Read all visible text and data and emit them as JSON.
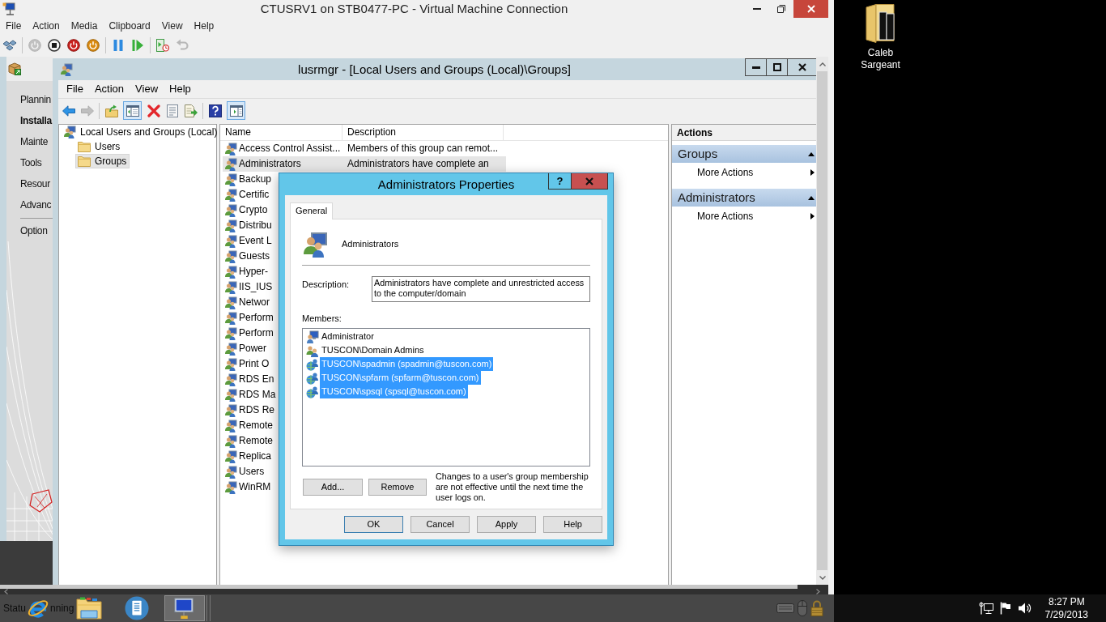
{
  "vm_window": {
    "title": "CTUSRV1 on STB0477-PC - Virtual Machine Connection",
    "menu": [
      "File",
      "Action",
      "Media",
      "Clipboard",
      "View",
      "Help"
    ],
    "toolbar": [
      {
        "kind": "ctrl-alt-del",
        "disabled": false
      },
      {
        "kind": "separator"
      },
      {
        "kind": "start",
        "disabled": true
      },
      {
        "kind": "turn-off",
        "disabled": false
      },
      {
        "kind": "shut-down",
        "disabled": false
      },
      {
        "kind": "save",
        "disabled": false
      },
      {
        "kind": "separator"
      },
      {
        "kind": "pause",
        "disabled": false
      },
      {
        "kind": "resume",
        "disabled": false
      },
      {
        "kind": "separator"
      },
      {
        "kind": "checkpoint",
        "disabled": false
      },
      {
        "kind": "revert",
        "disabled": true
      }
    ]
  },
  "sql_sidebar": {
    "items": [
      {
        "kind": "link",
        "label": "Plannin",
        "selected": false
      },
      {
        "kind": "link",
        "label": "Installa",
        "selected": true
      },
      {
        "kind": "link",
        "label": "Mainte",
        "selected": false
      },
      {
        "kind": "link",
        "label": "Tools",
        "selected": false
      },
      {
        "kind": "link",
        "label": "Resour",
        "selected": false
      },
      {
        "kind": "link",
        "label": "Advanc",
        "selected": false
      },
      {
        "kind": "separator"
      },
      {
        "kind": "link",
        "label": "Option",
        "selected": false
      }
    ]
  },
  "lusrmgr": {
    "title": "lusrmgr - [Local Users and Groups (Local)\\Groups]",
    "menu": [
      "File",
      "Action",
      "View",
      "Help"
    ],
    "toolbar": [
      {
        "kind": "back",
        "disabled": false,
        "pressed": false
      },
      {
        "kind": "forward",
        "disabled": true,
        "pressed": false
      },
      {
        "kind": "separator"
      },
      {
        "kind": "up",
        "disabled": false,
        "pressed": false
      },
      {
        "kind": "console-tree",
        "disabled": false,
        "pressed": true
      },
      {
        "kind": "delete",
        "disabled": false,
        "pressed": false
      },
      {
        "kind": "properties",
        "disabled": false,
        "pressed": false
      },
      {
        "kind": "export",
        "disabled": false,
        "pressed": false
      },
      {
        "kind": "separator"
      },
      {
        "kind": "help",
        "disabled": false,
        "pressed": false
      },
      {
        "kind": "action-pane",
        "disabled": false,
        "pressed": true
      }
    ],
    "tree": [
      {
        "label": "Local Users and Groups (Local)",
        "selected": false,
        "children": [
          {
            "label": "Users",
            "selected": false
          },
          {
            "label": "Groups",
            "selected": true
          }
        ]
      }
    ],
    "list": {
      "columns": [
        "Name",
        "Description"
      ],
      "rows": [
        {
          "name": "Access Control Assist...",
          "description": "Members of this group can remot...",
          "selected": false
        },
        {
          "name": "Administrators",
          "description": "Administrators have complete an",
          "selected": true
        },
        {
          "name": "Backup",
          "selected": false
        },
        {
          "name": "Certific",
          "selected": false
        },
        {
          "name": "Crypto",
          "selected": false
        },
        {
          "name": "Distribu",
          "selected": false
        },
        {
          "name": "Event L",
          "selected": false
        },
        {
          "name": "Guests",
          "selected": false
        },
        {
          "name": "Hyper-",
          "selected": false
        },
        {
          "name": "IIS_IUS",
          "selected": false
        },
        {
          "name": "Networ",
          "selected": false
        },
        {
          "name": "Perform",
          "selected": false
        },
        {
          "name": "Perform",
          "selected": false
        },
        {
          "name": "Power",
          "selected": false
        },
        {
          "name": "Print O",
          "selected": false
        },
        {
          "name": "RDS En",
          "selected": false
        },
        {
          "name": "RDS Ma",
          "selected": false
        },
        {
          "name": "RDS Re",
          "selected": false
        },
        {
          "name": "Remote",
          "selected": false
        },
        {
          "name": "Remote",
          "selected": false
        },
        {
          "name": "Replica",
          "selected": false
        },
        {
          "name": "Users",
          "selected": false
        },
        {
          "name": "WinRM",
          "selected": false
        }
      ]
    },
    "actions": {
      "title": "Actions",
      "sections": [
        {
          "title": "Groups",
          "items": [
            "More Actions"
          ]
        },
        {
          "title": "Administrators",
          "items": [
            "More Actions"
          ]
        }
      ]
    }
  },
  "dialog": {
    "title": "Administrators Properties",
    "help_button": "?",
    "tabs": [
      {
        "label": "General",
        "selected": true
      }
    ],
    "group_name": "Administrators",
    "description_label": "Description:",
    "description": "Administrators have complete and unrestricted access to the computer/domain",
    "members_label": "Members:",
    "members": [
      {
        "name": "Administrator",
        "kind": "user",
        "selected": false
      },
      {
        "name": "TUSCON\\Domain Admins",
        "kind": "group",
        "selected": false
      },
      {
        "name": "TUSCON\\spadmin (spadmin@tuscon.com)",
        "kind": "domain-user",
        "selected": true
      },
      {
        "name": "TUSCON\\spfarm (spfarm@tuscon.com)",
        "kind": "domain-user",
        "selected": true
      },
      {
        "name": "TUSCON\\spsql (spsql@tuscon.com)",
        "kind": "domain-user",
        "selected": true
      }
    ],
    "member_buttons": [
      "Add...",
      "Remove"
    ],
    "note": "Changes to a user's group membership are not effective until the next time the user logs on.",
    "buttons": [
      {
        "label": "OK",
        "default": true
      },
      {
        "label": "Cancel",
        "default": false
      },
      {
        "label": "Apply",
        "default": false
      },
      {
        "label": "Help",
        "default": false
      }
    ]
  },
  "status_bar": {
    "fragments": [
      "Statu",
      "nning"
    ]
  },
  "taskbar": {
    "apps": [
      {
        "kind": "browser",
        "active": false
      },
      {
        "kind": "file-explorer",
        "active": false
      },
      {
        "kind": "reader",
        "active": false
      },
      {
        "kind": "vm-connection",
        "active": true
      }
    ],
    "clock": {
      "time": "8:27 PM",
      "date": "7/29/2013"
    }
  },
  "desktop": {
    "icons": [
      {
        "label": "Caleb Sargeant"
      }
    ]
  }
}
